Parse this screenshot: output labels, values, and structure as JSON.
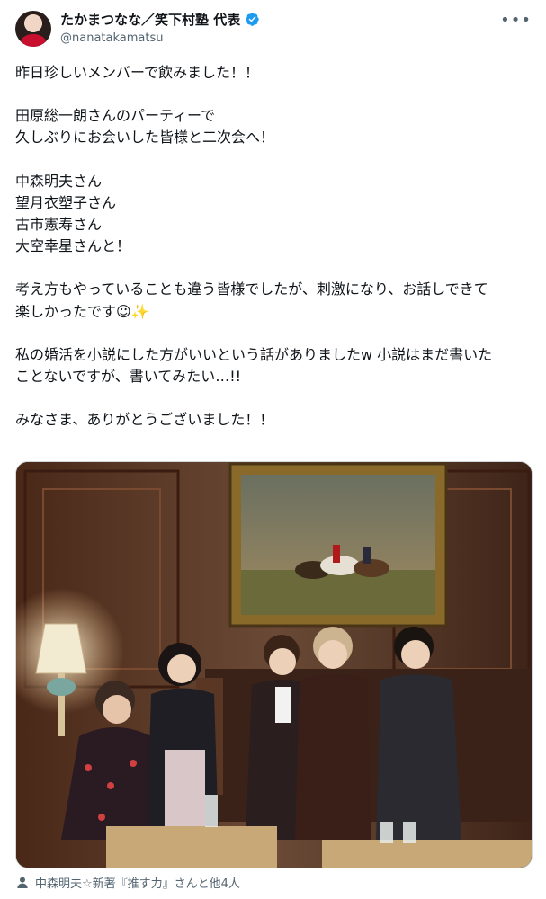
{
  "author": {
    "display_name": "たかまつなな／笑下村塾 代表",
    "handle": "@nanatakamatsu",
    "verified": true,
    "verified_color": "#1d9bf0"
  },
  "post": {
    "lines": {
      "l1": "昨日珍しいメンバーで飲みました！！",
      "l2": "田原総一朗さんのパーティーで",
      "l3": "久しぶりにお会いした皆様と二次会へ！",
      "l4": "中森明夫さん",
      "l5": "望月衣塑子さん",
      "l6": "古市憲寿さん",
      "l7": "大空幸星さんと！",
      "l8": "考え方もやっていることも違う皆様でしたが、刺激になり、お話しできて",
      "l9": "楽しかったです☺✨",
      "l10": "私の婚活を小説にした方がいいという話がありましたw 小説はまだ書いた",
      "l11": "ことないですが、書いてみたい…!!",
      "l12": "みなさま、ありがとうございました！！"
    }
  },
  "media": {
    "tagged": "中森明夫☆新著『推す力』さんと他4人"
  },
  "icons": {
    "more": "more-icon",
    "verified": "verified-badge-icon",
    "person": "person-icon"
  }
}
